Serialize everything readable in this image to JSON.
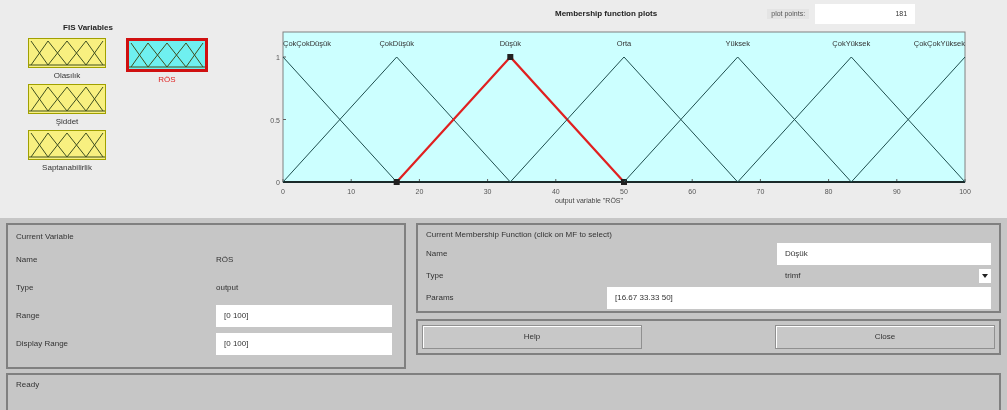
{
  "fis_variables": {
    "title": "FIS Variables",
    "items": [
      {
        "name": "Olasılık",
        "kind": "input",
        "selected": false
      },
      {
        "name": "Şiddet",
        "kind": "input",
        "selected": false
      },
      {
        "name": "Saptanabilirlik",
        "kind": "input",
        "selected": false
      },
      {
        "name": "RÖS",
        "kind": "output",
        "selected": true
      }
    ]
  },
  "plot": {
    "title": "Membership function plots",
    "plot_points_label": "plot points:",
    "plot_points": "181",
    "mf_states": [
      {
        "selected": false
      },
      {
        "selected": false
      },
      {
        "selected": true
      },
      {
        "selected": false
      },
      {
        "selected": false
      },
      {
        "selected": false
      },
      {
        "selected": false
      }
    ],
    "chart_data": {
      "type": "line",
      "xlabel": "output variable \"RÖS\"",
      "x": [
        0,
        16.67,
        33.33,
        50,
        66.67,
        83.33,
        100
      ],
      "xlim": [
        0,
        100
      ],
      "ylim": [
        0,
        1.2
      ],
      "xticks": [
        0,
        10,
        20,
        30,
        40,
        50,
        60,
        70,
        80,
        90,
        100
      ],
      "yticks": [
        0,
        0.5,
        1
      ],
      "series": [
        {
          "name": "ÇokÇokDüşük",
          "color": "#1f4f4f",
          "values": [
            1,
            0,
            null,
            null,
            null,
            null,
            null
          ]
        },
        {
          "name": "ÇokDüşük",
          "color": "#1f4f4f",
          "values": [
            0,
            1,
            0,
            null,
            null,
            null,
            null
          ]
        },
        {
          "name": "Düşük",
          "color": "#e02020",
          "values": [
            null,
            0,
            1,
            0,
            null,
            null,
            null
          ]
        },
        {
          "name": "Orta",
          "color": "#1f4f4f",
          "values": [
            null,
            null,
            0,
            1,
            0,
            null,
            null
          ]
        },
        {
          "name": "Yüksek",
          "color": "#1f4f4f",
          "values": [
            null,
            null,
            null,
            0,
            1,
            0,
            null
          ]
        },
        {
          "name": "ÇokYüksek",
          "color": "#1f4f4f",
          "values": [
            null,
            null,
            null,
            null,
            0,
            1,
            0
          ]
        },
        {
          "name": "ÇokÇokYüksek",
          "color": "#1f4f4f",
          "values": [
            null,
            null,
            null,
            null,
            null,
            0,
            1
          ]
        }
      ]
    }
  },
  "current_variable": {
    "title": "Current Variable",
    "fields": [
      {
        "label": "Name",
        "value": "RÖS",
        "kind": "text"
      },
      {
        "label": "Type",
        "value": "output",
        "kind": "text"
      },
      {
        "label": "Range",
        "value": "[0 100]",
        "kind": "input"
      },
      {
        "label": "Display Range",
        "value": "[0 100]",
        "kind": "input"
      }
    ]
  },
  "current_mf": {
    "title": "Current Membership Function (click on MF to select)",
    "name_label": "Name",
    "name": "Düşük",
    "type_label": "Type",
    "type": "trimf",
    "params_label": "Params",
    "params": "[16.67 33.33 50]"
  },
  "buttons": [
    "Help",
    "Close"
  ],
  "status_bar": "Ready"
}
